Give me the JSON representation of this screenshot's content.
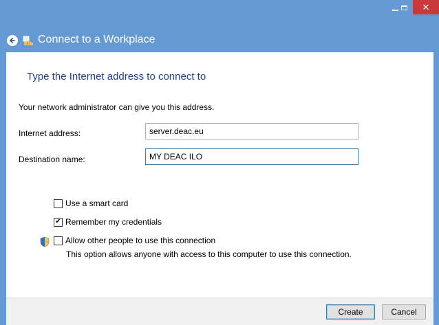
{
  "window": {
    "title": "Connect to a Workplace",
    "minimize_icon": "minimize-icon",
    "maximize_icon": "maximize-icon",
    "close_icon": "close-icon",
    "close_glyph": "✕"
  },
  "heading": "Type the Internet address to connect to",
  "intro": "Your network administrator can give you this address.",
  "fields": {
    "internet_address": {
      "label": "Internet address:",
      "value": "server.deac.eu"
    },
    "destination_name": {
      "label": "Destination name:",
      "value": "MY DEAC ILO"
    }
  },
  "options": {
    "smart_card": {
      "label": "Use a smart card",
      "checked": false
    },
    "remember": {
      "label": "Remember my credentials",
      "checked": true,
      "check_glyph": "✔"
    },
    "allow_others": {
      "label": "Allow other people to use this connection",
      "checked": false
    },
    "allow_note": "This option allows anyone with access to this computer to use this connection."
  },
  "buttons": {
    "create": "Create",
    "cancel": "Cancel"
  },
  "colors": {
    "frame": "#6599d3",
    "heading": "#1f3e8c",
    "close": "#c9383a"
  }
}
